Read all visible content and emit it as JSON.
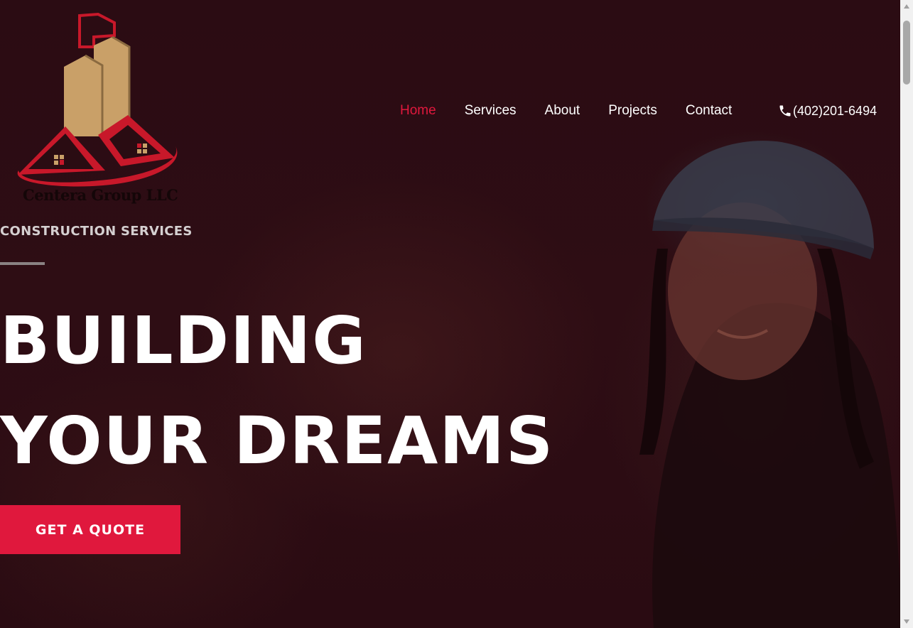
{
  "brand": {
    "name": "Centera Group LLC",
    "colors": {
      "accent": "#e0183d",
      "logo_red": "#c8182a",
      "logo_gold": "#c9a068",
      "background": "#2a0c12"
    }
  },
  "nav": {
    "items": [
      {
        "label": "Home",
        "active": true
      },
      {
        "label": "Services",
        "active": false
      },
      {
        "label": "About",
        "active": false
      },
      {
        "label": "Projects",
        "active": false
      },
      {
        "label": "Contact",
        "active": false
      }
    ],
    "phone": {
      "icon": "phone-icon",
      "number": "(402)201-6494"
    }
  },
  "hero": {
    "tagline": "CONSTRUCTION SERVICES",
    "headline_line1": "BUILDING",
    "headline_line2": "YOUR DREAMS",
    "cta_label": "GET A QUOTE"
  },
  "scrollbar": {
    "position": 0
  }
}
